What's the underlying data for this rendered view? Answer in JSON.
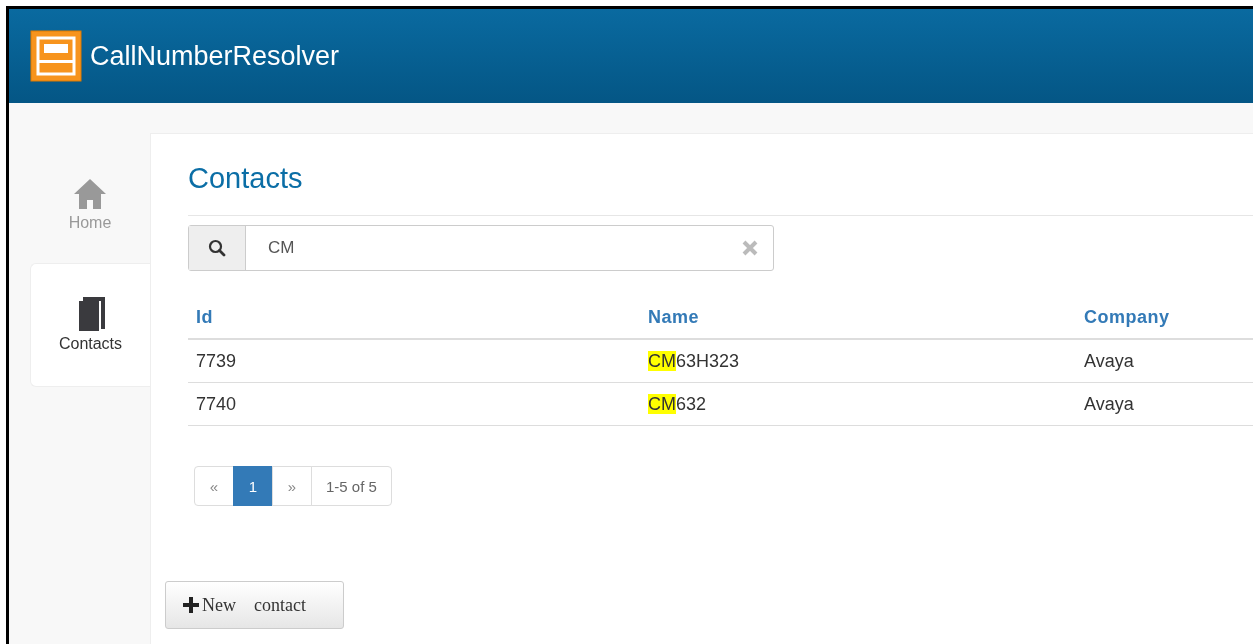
{
  "app": {
    "title": "CallNumberResolver"
  },
  "sidebar": {
    "items": [
      {
        "label": "Home",
        "kind": "home",
        "selected": false
      },
      {
        "label": "Contacts",
        "kind": "book",
        "selected": true
      }
    ]
  },
  "page": {
    "title": "Contacts"
  },
  "search": {
    "value": "CM"
  },
  "table": {
    "columns": [
      "Id",
      "Name",
      "Company"
    ],
    "rows": [
      {
        "id": "7739",
        "name_match": "CM",
        "name_rest": "63H323",
        "company": "Avaya"
      },
      {
        "id": "7740",
        "name_match": "CM",
        "name_rest": "632",
        "company": "Avaya"
      }
    ]
  },
  "pagination": {
    "prev": "«",
    "pages": [
      {
        "label": "1",
        "selected": true
      }
    ],
    "next": "»",
    "summary": "1-5 of 5"
  },
  "new_button": {
    "label": "New    contact"
  }
}
